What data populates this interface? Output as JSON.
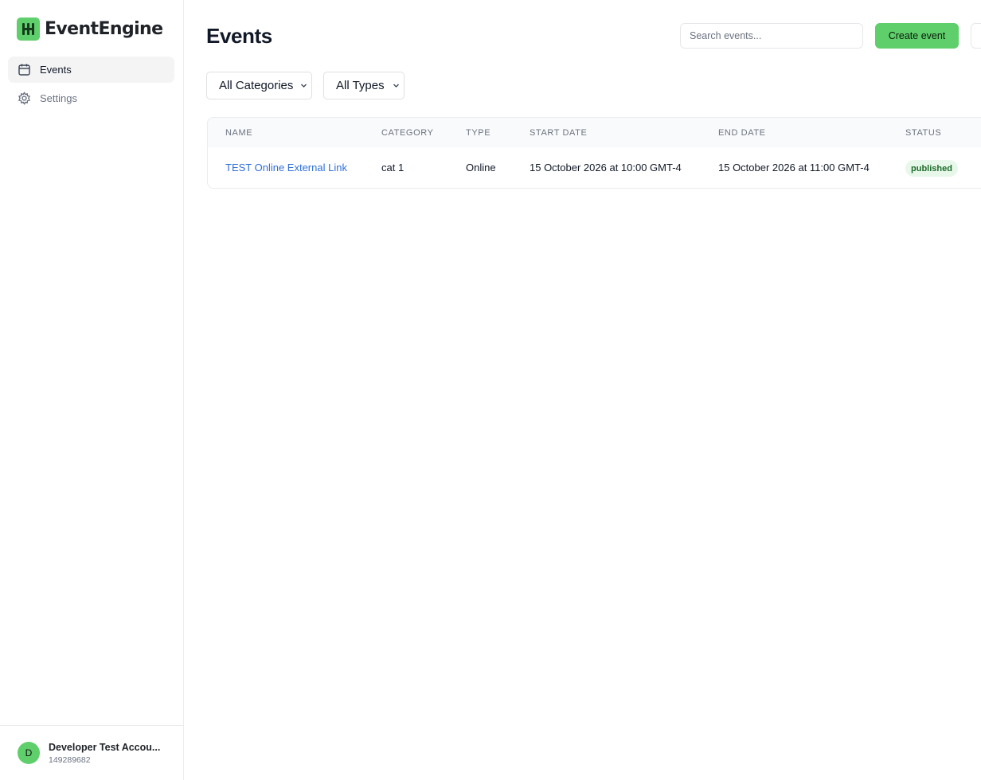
{
  "brand": {
    "name": "EventEngine",
    "icon": "brand-logo-icon",
    "accent": "#5ecf6a"
  },
  "sidebar": {
    "items": [
      {
        "label": "Events",
        "icon": "calendar-icon",
        "active": true
      },
      {
        "label": "Settings",
        "icon": "gear-icon",
        "active": false
      }
    ]
  },
  "account": {
    "initial": "D",
    "name": "Developer Test Accou...",
    "id": "149289682"
  },
  "page": {
    "title": "Events"
  },
  "search": {
    "placeholder": "Search events...",
    "value": ""
  },
  "toolbar": {
    "create_label": "Create event"
  },
  "filters": {
    "category": "All Categories",
    "type": "All Types"
  },
  "table": {
    "columns": [
      "NAME",
      "CATEGORY",
      "TYPE",
      "START DATE",
      "END DATE",
      "STATUS"
    ],
    "rows": [
      {
        "name": "TEST Online External Link",
        "category": "cat 1",
        "type": "Online",
        "start": "15 October 2026 at 10:00 GMT-4",
        "end": "15 October 2026 at 11:00 GMT-4",
        "status": "published",
        "status_color": "#1f6b2b"
      }
    ]
  }
}
